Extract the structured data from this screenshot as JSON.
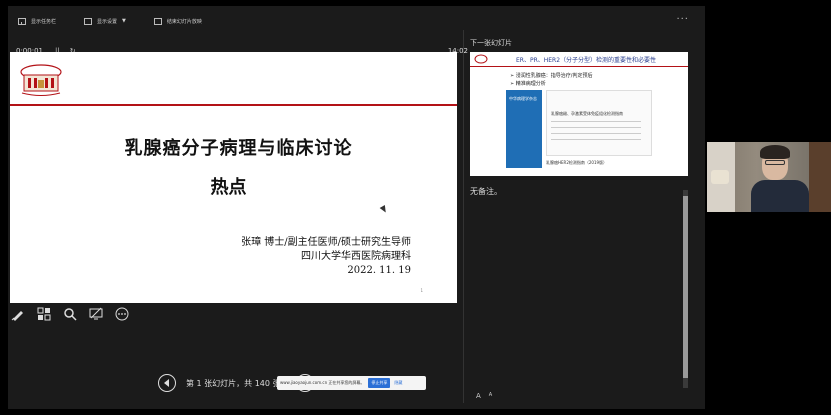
{
  "toolbar": {
    "item1": "显示任务栏",
    "item2": "显示设置",
    "item2_caret": "▼",
    "item3": "结束幻灯片放映",
    "more": "···"
  },
  "timer": {
    "elapsed": "0:00:01",
    "pause": "||",
    "reset": "↻",
    "clock": "14:02"
  },
  "slide": {
    "title": "乳腺癌分子病理与临床讨论",
    "subtitle": "热点",
    "author_line1": "张璋  博士/副主任医师/硕士研究生导师",
    "author_line2": "四川大学华西医院病理科",
    "author_line3": "2022. 11. 19",
    "page": "1"
  },
  "nav": {
    "count": "第 1 张幻灯片，共 140 张"
  },
  "share_banner": {
    "text": "www.jiaoyaojun.com.cn 正在共享您的屏幕。",
    "stop": "停止共享",
    "hide": "隐藏"
  },
  "next_panel": {
    "label": "下一张幻灯片",
    "title": "ER、PR、HER2（分子分型）检测的重要性和必要性",
    "bullet1": "➢ 浸润性乳腺癌：指导治疗/判定预后",
    "bullet2": "➢ 精准病理分析",
    "journal": "中华病理学杂志",
    "doc_title": "乳腺癌雌、孕激素受体免疫组化检测指南",
    "caption": "乳腺癌HER2检测指南（2019版）"
  },
  "notes": {
    "text": "无备注。"
  },
  "font_controls": {
    "increase": "A",
    "decrease": "A"
  }
}
